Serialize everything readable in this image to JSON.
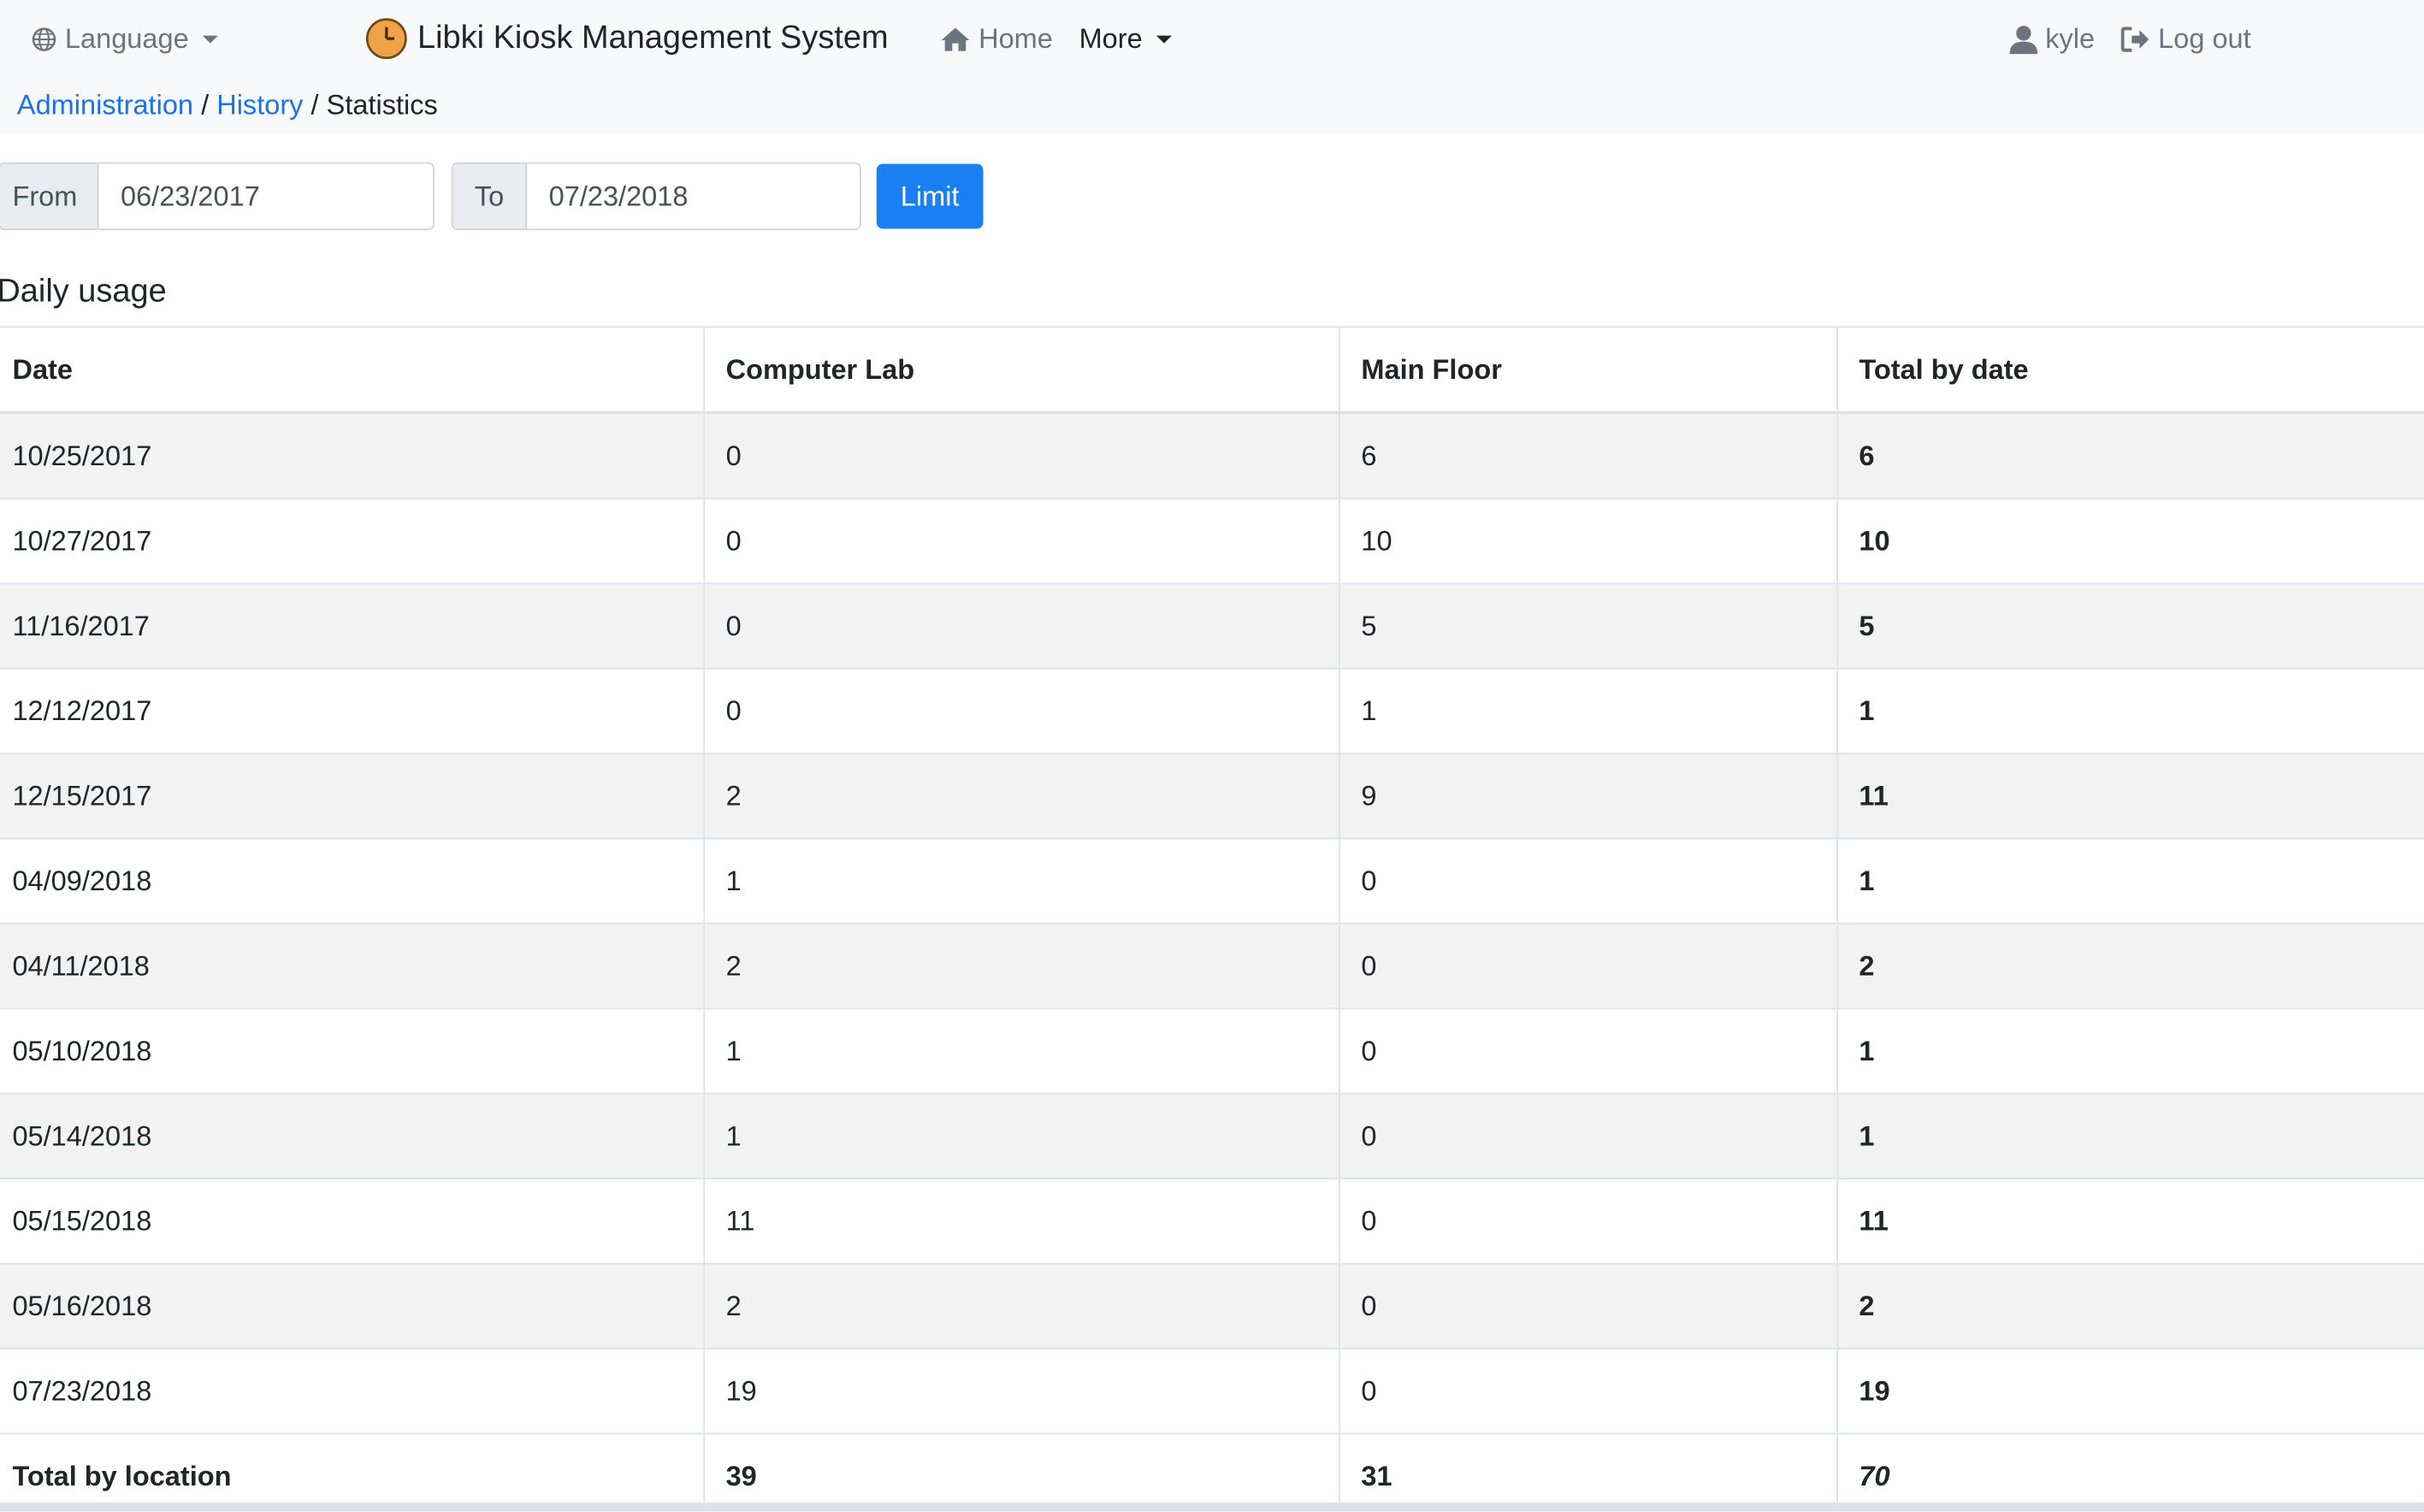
{
  "nav": {
    "language_label": "Language",
    "brand_title": "Libki Kiosk Management System",
    "home_label": "Home",
    "more_label": "More",
    "user_label": "kyle",
    "logout_label": "Log out"
  },
  "breadcrumb": {
    "admin": "Administration",
    "sep1": "/",
    "history": "History",
    "sep2": "/",
    "current": "Statistics"
  },
  "filter": {
    "from_label": "From",
    "from_value": "06/23/2017",
    "to_label": "To",
    "to_value": "07/23/2018",
    "limit_label": "Limit"
  },
  "section_title": "Daily usage",
  "table": {
    "headers": [
      "Date",
      "Computer Lab",
      "Main Floor",
      "Total by date"
    ],
    "rows": [
      [
        "10/25/2017",
        "0",
        "6",
        "6"
      ],
      [
        "10/27/2017",
        "0",
        "10",
        "10"
      ],
      [
        "11/16/2017",
        "0",
        "5",
        "5"
      ],
      [
        "12/12/2017",
        "0",
        "1",
        "1"
      ],
      [
        "12/15/2017",
        "2",
        "9",
        "11"
      ],
      [
        "04/09/2018",
        "1",
        "0",
        "1"
      ],
      [
        "04/11/2018",
        "2",
        "0",
        "2"
      ],
      [
        "05/10/2018",
        "1",
        "0",
        "1"
      ],
      [
        "05/14/2018",
        "1",
        "0",
        "1"
      ],
      [
        "05/15/2018",
        "11",
        "0",
        "11"
      ],
      [
        "05/16/2018",
        "2",
        "0",
        "2"
      ],
      [
        "07/23/2018",
        "19",
        "0",
        "19"
      ]
    ],
    "footer": [
      "Total by location",
      "39",
      "31",
      "70"
    ]
  },
  "colors": {
    "accent": "#1a7ff2",
    "link": "#1a73e8",
    "clock_icon": "#f0a346"
  }
}
